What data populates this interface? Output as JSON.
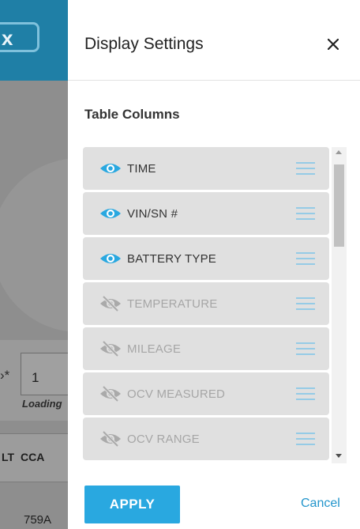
{
  "background": {
    "logo_glyph": "x",
    "field_label": "*",
    "field_prefix": "›",
    "field_value": "1",
    "loading_text": "Loading",
    "table_headers": [
      "LT",
      "CCA"
    ],
    "table_cell": "759A"
  },
  "drawer": {
    "title": "Display Settings",
    "close_glyph": "✕",
    "section_title": "Table Columns",
    "columns": [
      {
        "label": "TIME",
        "visible": true
      },
      {
        "label": "VIN/SN #",
        "visible": true
      },
      {
        "label": "BATTERY TYPE",
        "visible": true
      },
      {
        "label": "TEMPERATURE",
        "visible": false
      },
      {
        "label": "MILEAGE",
        "visible": false
      },
      {
        "label": "OCV MEASURED",
        "visible": false
      },
      {
        "label": "OCV RANGE",
        "visible": false
      }
    ],
    "apply_label": "APPLY",
    "cancel_label": "Cancel"
  },
  "colors": {
    "accent": "#29a8e0",
    "eye_visible": "#29a8e0",
    "eye_hidden": "#aaaaaa",
    "drag_handle": "#7cc4e8"
  },
  "icons": {
    "visible": "eye-icon",
    "hidden": "eye-slash-icon",
    "drag": "drag-handle-icon",
    "close": "close-icon"
  }
}
